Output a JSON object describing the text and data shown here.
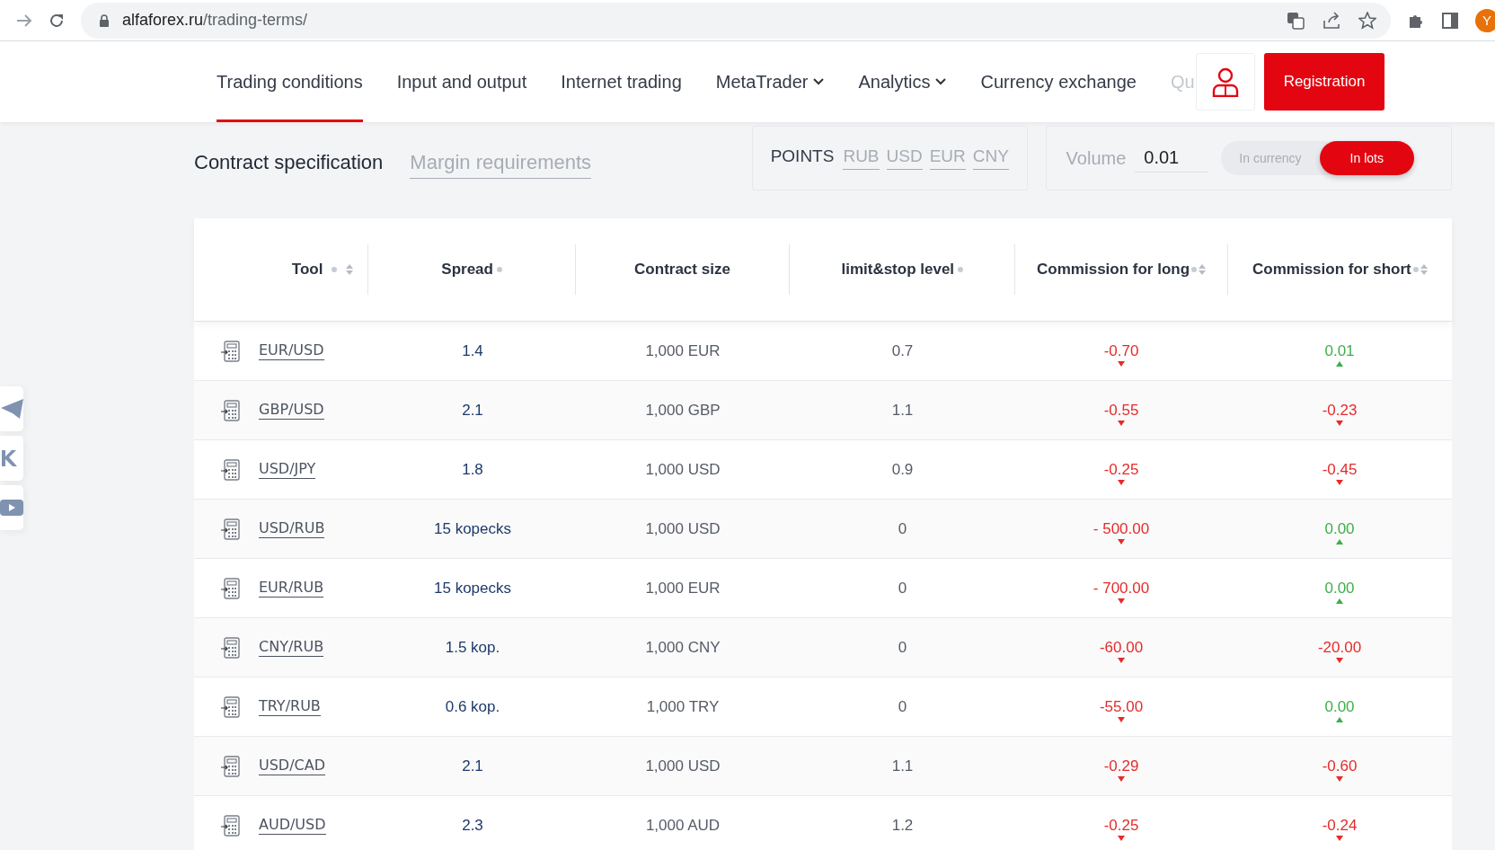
{
  "browser": {
    "url_host": "alfaforex.ru",
    "url_path": "/trading-terms/",
    "profile_initial": "Y"
  },
  "nav": {
    "items": [
      {
        "label": "Trading conditions",
        "selected": true,
        "dropdown": false
      },
      {
        "label": "Input and output",
        "selected": false,
        "dropdown": false
      },
      {
        "label": "Internet trading",
        "selected": false,
        "dropdown": false
      },
      {
        "label": "MetaTrader",
        "selected": false,
        "dropdown": true
      },
      {
        "label": "Analytics",
        "selected": false,
        "dropdown": true
      },
      {
        "label": "Currency exchange",
        "selected": false,
        "dropdown": false
      },
      {
        "label": "Qu",
        "selected": false,
        "dropdown": false
      }
    ],
    "register_button": "Registration"
  },
  "subtabs": [
    {
      "label": "Contract specification",
      "selected": true
    },
    {
      "label": "Margin requirements",
      "selected": false
    }
  ],
  "units": [
    {
      "label": "POINTS",
      "selected": true
    },
    {
      "label": "RUB",
      "selected": false
    },
    {
      "label": "USD",
      "selected": false
    },
    {
      "label": "EUR",
      "selected": false
    },
    {
      "label": "CNY",
      "selected": false
    }
  ],
  "volume": {
    "label": "Volume",
    "value": "0.01",
    "modes": [
      {
        "label": "In currency",
        "selected": false
      },
      {
        "label": "In lots",
        "selected": true
      }
    ]
  },
  "table": {
    "columns": [
      {
        "label": "Tool",
        "info": true,
        "sortable": true
      },
      {
        "label": "Spread",
        "info": true,
        "sortable": false
      },
      {
        "label": "Contract size",
        "info": false,
        "sortable": false
      },
      {
        "label": "limit&stop level",
        "info": true,
        "sortable": false
      },
      {
        "label": "Commission for long",
        "info": true,
        "sortable": true
      },
      {
        "label": "Commission for short",
        "info": true,
        "sortable": true
      }
    ],
    "rows": [
      {
        "tool": "EUR/USD",
        "spread": "1.4",
        "contract_size": "1,000 EUR",
        "level": "0.7",
        "long": {
          "value": "-0.70",
          "rising": false
        },
        "short": {
          "value": "0.01",
          "rising": true
        }
      },
      {
        "tool": "GBP/USD",
        "spread": "2.1",
        "contract_size": "1,000 GBP",
        "level": "1.1",
        "long": {
          "value": "-0.55",
          "rising": false
        },
        "short": {
          "value": "-0.23",
          "rising": false
        }
      },
      {
        "tool": "USD/JPY",
        "spread": "1.8",
        "contract_size": "1,000 USD",
        "level": "0.9",
        "long": {
          "value": "-0.25",
          "rising": false
        },
        "short": {
          "value": "-0.45",
          "rising": false
        }
      },
      {
        "tool": "USD/RUB",
        "spread": "15 kopecks",
        "contract_size": "1,000 USD",
        "level": "0",
        "long": {
          "value": "- 500.00",
          "rising": false
        },
        "short": {
          "value": "0.00",
          "rising": true
        }
      },
      {
        "tool": "EUR/RUB",
        "spread": "15 kopecks",
        "contract_size": "1,000 EUR",
        "level": "0",
        "long": {
          "value": "- 700.00",
          "rising": false
        },
        "short": {
          "value": "0.00",
          "rising": true
        }
      },
      {
        "tool": "CNY/RUB",
        "spread": "1.5 kop.",
        "contract_size": "1,000 CNY",
        "level": "0",
        "long": {
          "value": "-60.00",
          "rising": false
        },
        "short": {
          "value": "-20.00",
          "rising": false
        }
      },
      {
        "tool": "TRY/RUB",
        "spread": "0.6 kop.",
        "contract_size": "1,000 TRY",
        "level": "0",
        "long": {
          "value": "-55.00",
          "rising": false
        },
        "short": {
          "value": "0.00",
          "rising": true
        }
      },
      {
        "tool": "USD/CAD",
        "spread": "2.1",
        "contract_size": "1,000 USD",
        "level": "1.1",
        "long": {
          "value": "-0.29",
          "rising": false
        },
        "short": {
          "value": "-0.60",
          "rising": false
        }
      },
      {
        "tool": "AUD/USD",
        "spread": "2.3",
        "contract_size": "1,000 AUD",
        "level": "1.2",
        "long": {
          "value": "-0.25",
          "rising": false
        },
        "short": {
          "value": "-0.24",
          "rising": false
        }
      }
    ]
  },
  "social": [
    {
      "kind": "telegram"
    },
    {
      "kind": "vk"
    },
    {
      "kind": "youtube"
    }
  ]
}
